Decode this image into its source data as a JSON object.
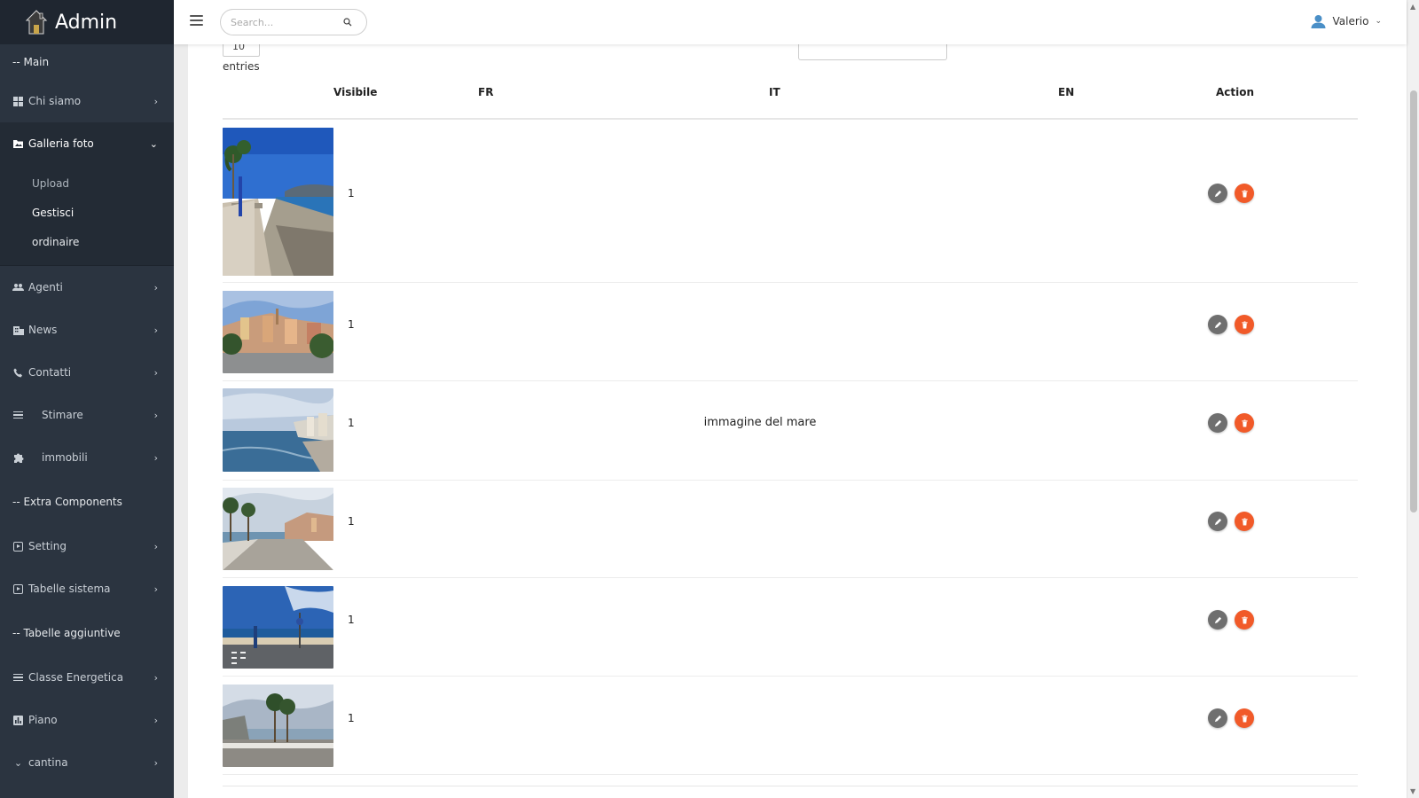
{
  "brand": {
    "name": "Admin"
  },
  "sidebar": {
    "main_heading": "-- Main",
    "items": [
      {
        "label": "Chi siamo",
        "icon": "dashboard-icon"
      },
      {
        "label": "Galleria foto",
        "icon": "photo-folder-icon"
      }
    ],
    "gallery_submenu": [
      {
        "label": "Upload"
      },
      {
        "label": "Gestisci"
      },
      {
        "label": "ordinaire"
      }
    ],
    "items_after": [
      {
        "label": "Agenti",
        "icon": "people-icon"
      },
      {
        "label": "News",
        "icon": "building-icon"
      },
      {
        "label": "Contatti",
        "icon": "phone-icon"
      },
      {
        "label": "Stimare",
        "icon": "list-icon"
      },
      {
        "label": "immobili",
        "icon": "puzzle-icon"
      }
    ],
    "extra_heading": "-- Extra Components",
    "extra_items": [
      {
        "label": "Setting",
        "icon": "play-box-icon"
      },
      {
        "label": "Tabelle sistema",
        "icon": "play-box-icon"
      }
    ],
    "added_heading": "-- Tabelle aggiuntive",
    "added_items": [
      {
        "label": "Classe Energetica",
        "icon": "list-icon"
      },
      {
        "label": "Piano",
        "icon": "chart-box-icon"
      },
      {
        "label": "cantina",
        "icon": "chevron-down-icon"
      }
    ]
  },
  "topbar": {
    "search_placeholder": "Search...",
    "user_name": "Valerio"
  },
  "table": {
    "length_value": "10",
    "entries_label": "entries",
    "columns": {
      "visibile": "Visibile",
      "fr": "FR",
      "it": "IT",
      "en": "EN",
      "action": "Action"
    },
    "rows": [
      {
        "visibile": "1",
        "fr": "",
        "it": "",
        "en": "",
        "photo": "promenade-palms-sea"
      },
      {
        "visibile": "1",
        "fr": "",
        "it": "",
        "en": "",
        "photo": "colorful-town-hill"
      },
      {
        "visibile": "1",
        "fr": "",
        "it": "immagine del mare",
        "en": "",
        "photo": "sea-coast-buildings"
      },
      {
        "visibile": "1",
        "fr": "",
        "it": "",
        "en": "",
        "photo": "seafront-walkway-town"
      },
      {
        "visibile": "1",
        "fr": "",
        "it": "",
        "en": "",
        "photo": "road-crossing-beach"
      },
      {
        "visibile": "1",
        "fr": "",
        "it": "",
        "en": "",
        "photo": "palms-beach-cloudy"
      }
    ]
  },
  "colors": {
    "sidebar_bg": "#2b3440",
    "edit_button": "#6f6f6f",
    "delete_button": "#f15a29",
    "user_icon": "#4a8fc7"
  }
}
